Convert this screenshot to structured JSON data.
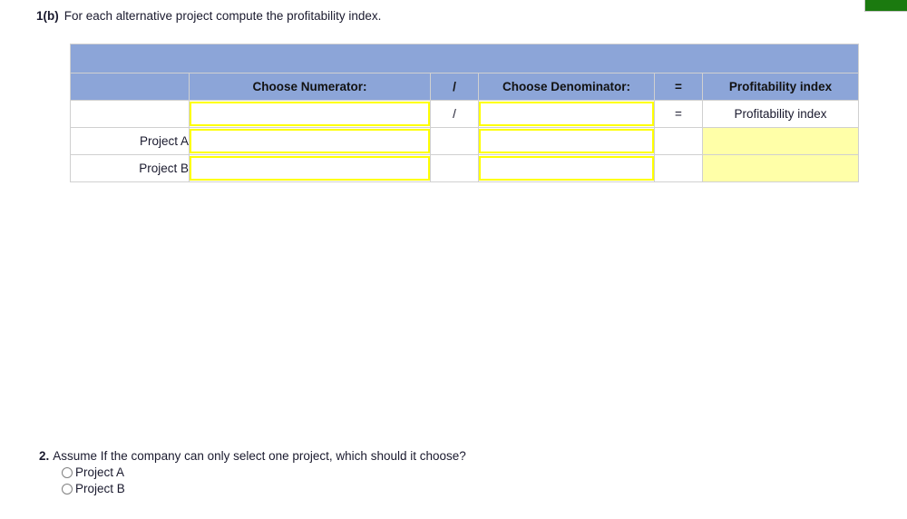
{
  "page": {
    "colors": {
      "header_blue": "#8ca5d8",
      "field_border_yellow": "#ffff00",
      "output_yellow": "#ffffa8",
      "marker_green": "#1b7a0f",
      "grid_gray": "#d0d0d0"
    }
  },
  "question1": {
    "number": "1(b)",
    "text": "For each alternative project compute the profitability index."
  },
  "table": {
    "headers": {
      "label": "",
      "numerator": "Choose Numerator:",
      "slash": "/",
      "denominator": "Choose Denominator:",
      "equals": "=",
      "result": "Profitability index"
    },
    "formula_row": {
      "label": "",
      "numerator_value": "",
      "slash": "/",
      "denominator_value": "",
      "equals": "=",
      "result": "Profitability index"
    },
    "rows": [
      {
        "label": "Project A",
        "numerator_value": "",
        "slash": "",
        "denominator_value": "",
        "equals": "",
        "result": ""
      },
      {
        "label": "Project B",
        "numerator_value": "",
        "slash": "",
        "denominator_value": "",
        "equals": "",
        "result": ""
      }
    ]
  },
  "question2": {
    "number": "2.",
    "text": "Assume If the company can only select one project, which should it choose?",
    "options": [
      {
        "label": "Project A",
        "selected": false
      },
      {
        "label": "Project B",
        "selected": false
      }
    ]
  }
}
